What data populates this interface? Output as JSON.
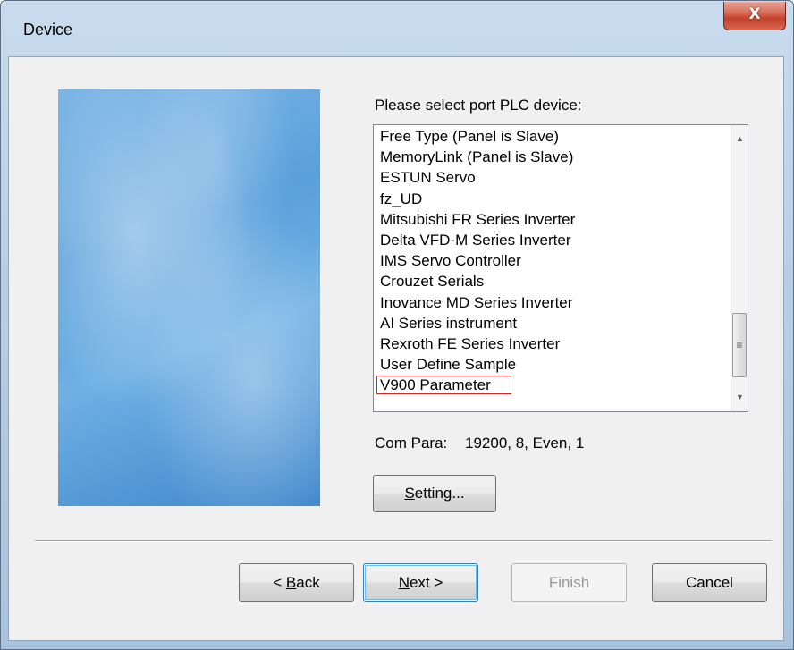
{
  "window": {
    "title": "Device",
    "close_glyph": "X"
  },
  "wizard": {
    "prompt": "Please select port PLC device:",
    "devices": [
      "Free Type (Panel is Slave)",
      "MemoryLink (Panel is Slave)",
      "ESTUN Servo",
      "fz_UD",
      "Mitsubishi FR Series Inverter",
      "Delta VFD-M Series Inverter",
      "IMS Servo Controller",
      "Crouzet Serials",
      "Inovance MD Series Inverter",
      "AI Series instrument",
      "Rexroth FE Series Inverter",
      "User Define Sample",
      "V900 Parameter"
    ],
    "focused_device": "V900 Parameter",
    "com_label": "Com Para:",
    "com_value": "19200, 8, Even, 1",
    "setting_button": {
      "prefix": "",
      "mnemonic": "S",
      "rest": "etting..."
    }
  },
  "buttons": {
    "back": {
      "prefix": "< ",
      "mnemonic": "B",
      "rest": "ack"
    },
    "next": {
      "prefix": "",
      "mnemonic": "N",
      "rest": "ext >"
    },
    "finish": "Finish",
    "cancel": "Cancel"
  },
  "scrollbar": {
    "up_glyph": "▲",
    "down_glyph": "▼",
    "thumb_glyph": "≡"
  },
  "colors": {
    "focus_outline": "#e02020",
    "default_button_border": "#3c7fb1"
  }
}
